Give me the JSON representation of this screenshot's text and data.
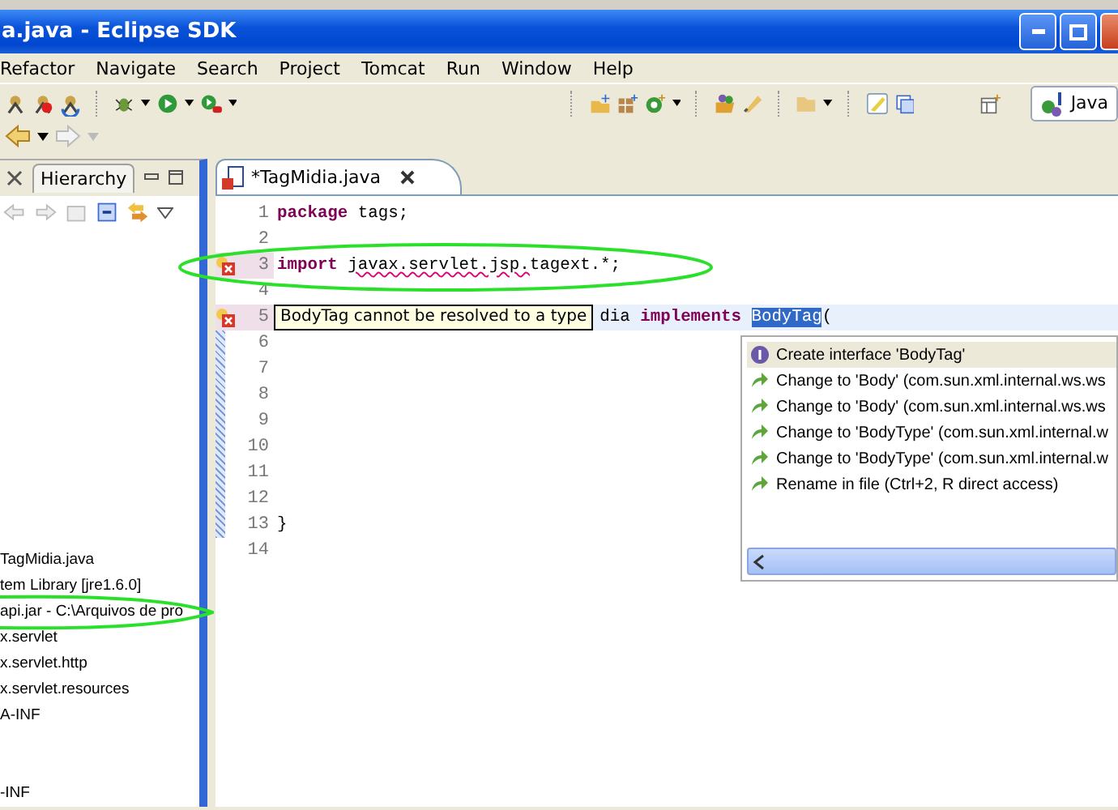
{
  "window": {
    "title": "a.java - Eclipse SDK"
  },
  "menu": [
    "Refactor",
    "Navigate",
    "Search",
    "Project",
    "Tomcat",
    "Run",
    "Window",
    "Help"
  ],
  "perspective": {
    "label": "Java",
    "selected": true
  },
  "left_panel": {
    "tab": {
      "label": "Hierarchy",
      "selected": false
    },
    "tree": [
      "TagMidia.java",
      "tem Library [jre1.6.0]",
      "api.jar - C:\\Arquivos de pro",
      "x.servlet",
      "x.servlet.http",
      "x.servlet.resources",
      "A-INF",
      "-INF"
    ]
  },
  "editor": {
    "tab": {
      "label": "*TagMidia.java",
      "selected": true
    },
    "lines": [
      {
        "number": "1",
        "error": false,
        "tokens": [
          {
            "text": "package",
            "kind": "keyword"
          },
          {
            "text": " tags;",
            "kind": "plain"
          }
        ]
      },
      {
        "number": "2",
        "error": false
      },
      {
        "number": "3",
        "error": true,
        "tokens": [
          {
            "text": "import ",
            "kind": "keyword"
          },
          {
            "text": "javax.servlet.jsp.",
            "kind": "error"
          },
          {
            "text": "tagext.*;",
            "kind": "plain"
          }
        ]
      },
      {
        "number": "4",
        "error": false
      },
      {
        "number": "5",
        "error": true,
        "tooltip": "BodyTag cannot be resolved to a type",
        "tokens": [
          {
            "text": "dia ",
            "kind": "plain"
          },
          {
            "text": "implements ",
            "kind": "keyword"
          },
          {
            "text": "BodyTag",
            "kind": "selection"
          },
          {
            "text": "(",
            "kind": "plain"
          }
        ]
      },
      {
        "number": "6",
        "error": false
      },
      {
        "number": "7",
        "error": false
      },
      {
        "number": "8",
        "error": false
      },
      {
        "number": "9",
        "error": false
      },
      {
        "number": "10",
        "error": false
      },
      {
        "number": "11",
        "error": false
      },
      {
        "number": "12",
        "error": false
      },
      {
        "number": "13",
        "error": false,
        "tokens": [
          {
            "text": "}",
            "kind": "plain"
          }
        ]
      },
      {
        "number": "14",
        "error": false
      }
    ],
    "quick_fix": [
      {
        "label": "Create interface 'BodyTag'",
        "kind": "create",
        "selected": true
      },
      {
        "label": "Change to 'Body' (com.sun.xml.internal.ws.ws",
        "kind": "change",
        "selected": false
      },
      {
        "label": "Change to 'Body' (com.sun.xml.internal.ws.ws",
        "kind": "change",
        "selected": false
      },
      {
        "label": "Change to 'BodyType' (com.sun.xml.internal.w",
        "kind": "change",
        "selected": false
      },
      {
        "label": "Change to 'BodyType' (com.sun.xml.internal.w",
        "kind": "change",
        "selected": false
      },
      {
        "label": "Rename in file (Ctrl+2, R direct access)",
        "kind": "change",
        "selected": false
      }
    ]
  }
}
